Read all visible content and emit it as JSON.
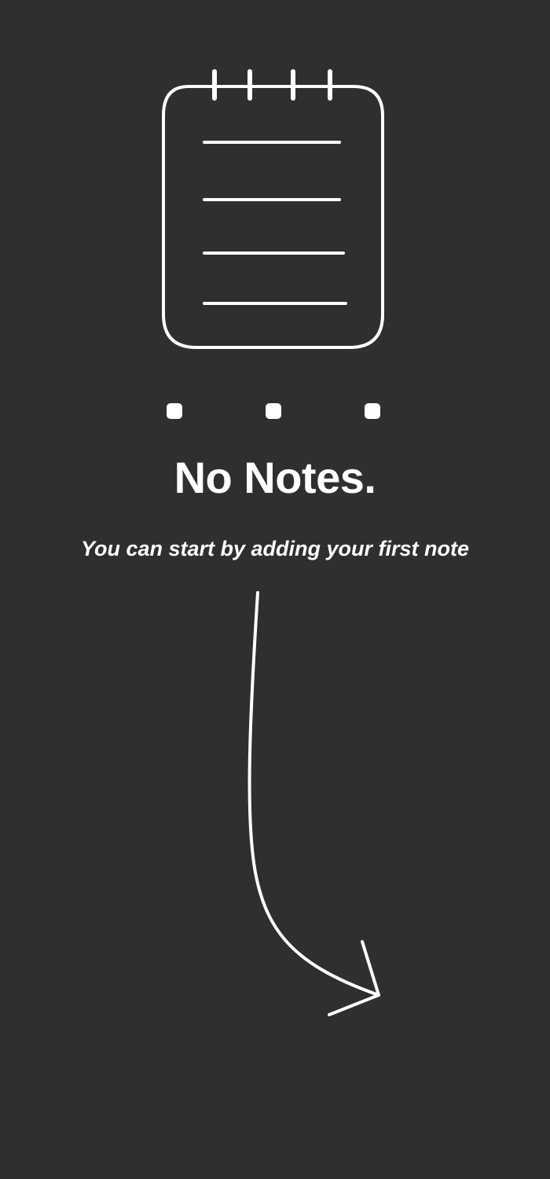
{
  "empty_state": {
    "title": "No Notes.",
    "subtitle": "You can start by adding your first note",
    "icon": "notepad-icon",
    "decoration": [
      "dots-icon",
      "curved-arrow-icon"
    ]
  },
  "colors": {
    "background": "#2e2f31",
    "foreground": "#ffffff"
  }
}
